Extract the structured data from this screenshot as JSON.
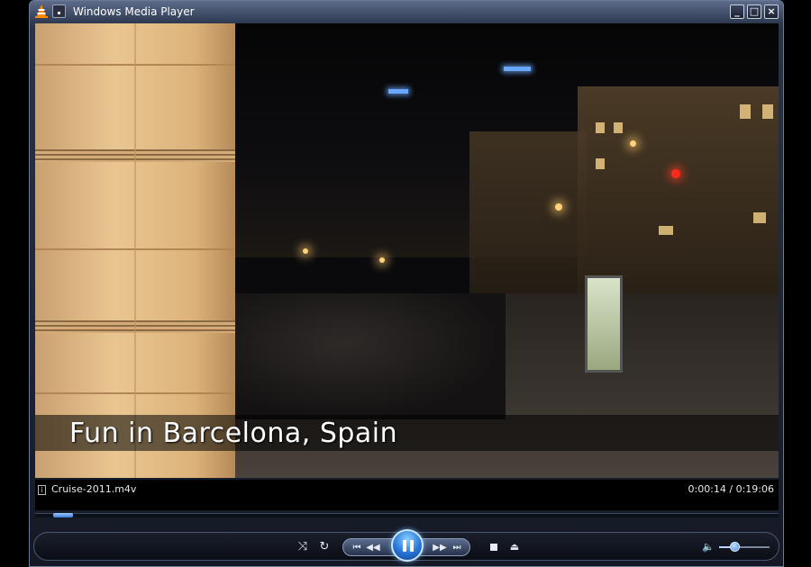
{
  "window": {
    "title": "Windows Media Player",
    "app_icon": "vlc-cone-icon",
    "minimize_label": "_",
    "maximize_label": "□",
    "close_label": "×"
  },
  "video": {
    "caption": "Fun in Barcelona, Spain",
    "scene": "night city street"
  },
  "info": {
    "file_name": "Cruise-2011.m4v",
    "time": "0:00:14 / 0:19:06"
  },
  "playback": {
    "progress_fraction": 0.012,
    "volume_fraction": 0.3,
    "state": "playing"
  },
  "controls": {
    "shuffle_glyph": "⤨",
    "repeat_glyph": "↻",
    "prev_glyph": "⏮",
    "rewind_glyph": "◀◀",
    "forward_glyph": "▶▶",
    "next_glyph": "⏭",
    "eject_glyph": "⏏",
    "speaker_glyph": "🔈"
  },
  "colors": {
    "accent": "#2676d8",
    "frame": "#2a3346"
  }
}
